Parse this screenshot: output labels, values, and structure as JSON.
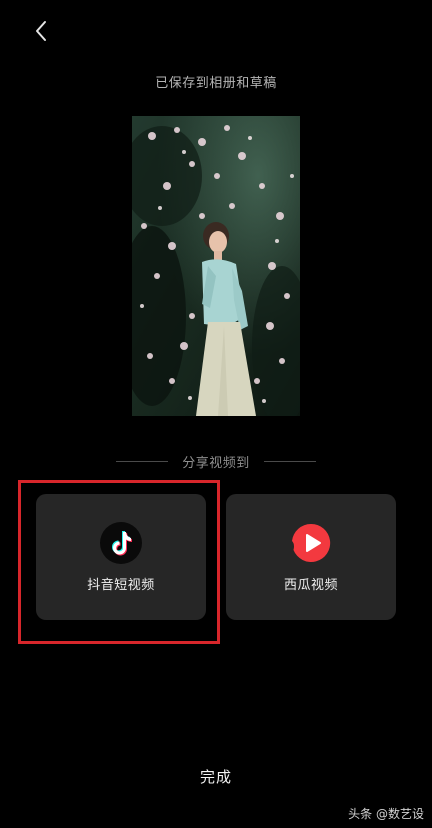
{
  "header": {
    "back_icon": "chevron-left-icon"
  },
  "status": {
    "saved_text": "已保存到相册和草稿"
  },
  "share": {
    "section_label": "分享视频到",
    "targets": [
      {
        "label": "抖音短视频",
        "icon": "douyin-icon",
        "highlighted": true
      },
      {
        "label": "西瓜视频",
        "icon": "xigua-video-icon",
        "highlighted": false
      }
    ],
    "highlight_color": "#d7262b"
  },
  "footer": {
    "done_label": "完成"
  },
  "watermark": {
    "text": "头条 @数艺设"
  }
}
